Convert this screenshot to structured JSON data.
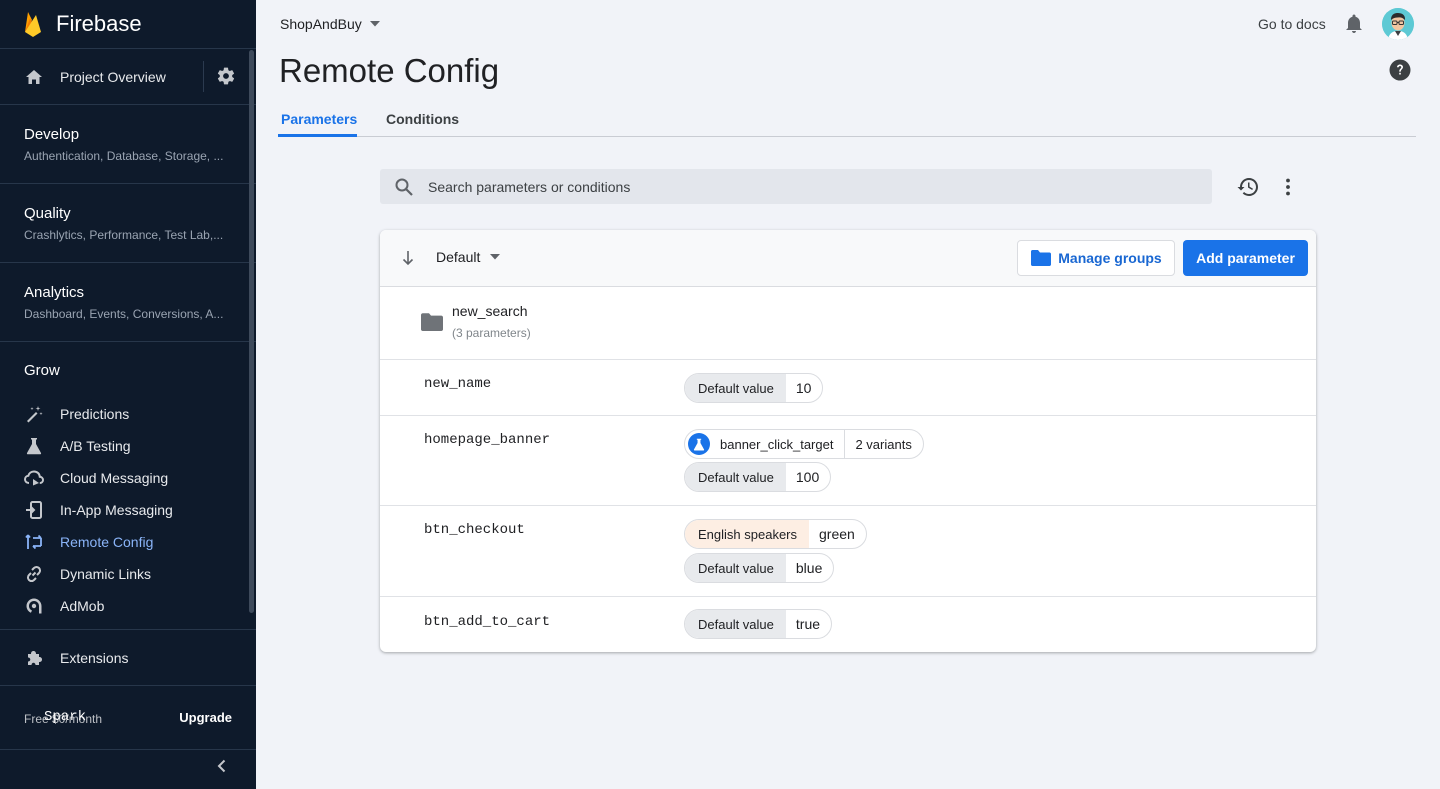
{
  "sidebar": {
    "brand": "Firebase",
    "project_overview": "Project Overview",
    "sections": [
      {
        "title": "Develop",
        "sub": "Authentication, Database, Storage, ..."
      },
      {
        "title": "Quality",
        "sub": "Crashlytics, Performance, Test Lab,..."
      },
      {
        "title": "Analytics",
        "sub": "Dashboard, Events, Conversions, A..."
      }
    ],
    "grow": {
      "title": "Grow",
      "items": [
        {
          "label": "Predictions",
          "icon": "wand-icon"
        },
        {
          "label": "A/B Testing",
          "icon": "flask-icon"
        },
        {
          "label": "Cloud Messaging",
          "icon": "cloud-messaging-icon"
        },
        {
          "label": "In-App Messaging",
          "icon": "in-app-messaging-icon"
        },
        {
          "label": "Remote Config",
          "icon": "remote-config-icon",
          "active": true
        },
        {
          "label": "Dynamic Links",
          "icon": "link-icon"
        },
        {
          "label": "AdMob",
          "icon": "admob-icon"
        }
      ]
    },
    "extensions": "Extensions",
    "plan": {
      "name": "Spark",
      "price": "Free $0/month",
      "upgrade": "Upgrade"
    }
  },
  "topbar": {
    "project": "ShopAndBuy",
    "docs": "Go to docs"
  },
  "page": {
    "title": "Remote Config",
    "tabs": [
      {
        "label": "Parameters",
        "active": true
      },
      {
        "label": "Conditions"
      }
    ],
    "search_placeholder": "Search parameters or conditions"
  },
  "card": {
    "sort_label": "Default",
    "manage_groups": "Manage groups",
    "add_parameter": "Add parameter",
    "group": {
      "name": "new_search",
      "count": "(3 parameters)"
    },
    "params": [
      {
        "name": "new_name",
        "values": [
          {
            "key": "Default value",
            "value": "10"
          }
        ]
      },
      {
        "name": "homepage_banner",
        "experiment": {
          "name": "banner_click_target",
          "variants": "2 variants"
        },
        "values": [
          {
            "key": "Default value",
            "value": "100"
          }
        ]
      },
      {
        "name": "btn_checkout",
        "values": [
          {
            "key": "English speakers",
            "value": "green",
            "condition": true
          },
          {
            "key": "Default value",
            "value": "blue"
          }
        ]
      },
      {
        "name": "btn_add_to_cart",
        "values": [
          {
            "key": "Default value",
            "value": "true"
          }
        ]
      }
    ]
  },
  "colors": {
    "accent": "#1a73e8",
    "sidebar_bg": "#0e1a2b",
    "condition_chip": "#fdeee3"
  }
}
